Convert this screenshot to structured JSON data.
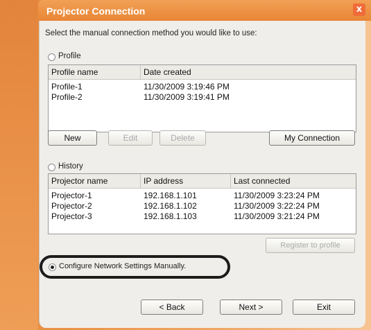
{
  "window": {
    "title": "Projector Connection",
    "close_glyph": "x"
  },
  "instruction": "Select the manual connection method you would like to use:",
  "profile": {
    "radio_label": "Profile",
    "columns": [
      "Profile name",
      "Date created"
    ],
    "rows": [
      [
        "Profile-1",
        "11/30/2009 3:19:46 PM"
      ],
      [
        "Profile-2",
        "11/30/2009 3:19:41 PM"
      ]
    ],
    "buttons": {
      "new": "New",
      "edit": "Edit",
      "delete": "Delete",
      "my_connection": "My Connection"
    }
  },
  "history": {
    "radio_label": "History",
    "columns": [
      "Projector name",
      "IP address",
      "Last connected"
    ],
    "rows": [
      [
        "Projector-1",
        "192.168.1.101",
        "11/30/2009 3:23:24 PM"
      ],
      [
        "Projector-2",
        "192.168.1.102",
        "11/30/2009 3:22:24 PM"
      ],
      [
        "Projector-3",
        "192.168.1.103",
        "11/30/2009 3:21:24 PM"
      ]
    ],
    "register_button": "Register to profile"
  },
  "manual": {
    "radio_label": "Configure Network Settings Manually."
  },
  "nav": {
    "back": "< Back",
    "next": "Next >",
    "exit": "Exit"
  }
}
